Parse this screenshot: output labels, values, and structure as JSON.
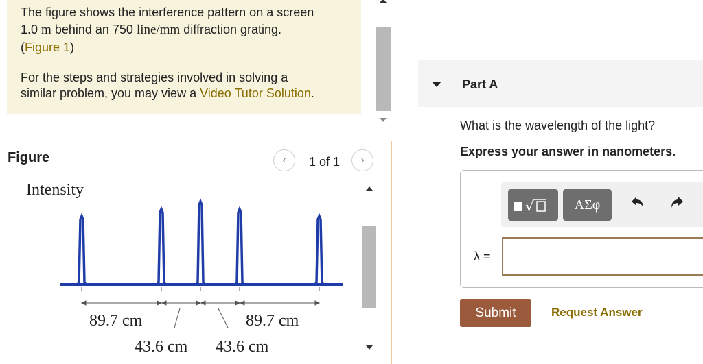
{
  "intro": {
    "line1": "The figure shows the interference pattern on a screen",
    "line2_value": "1.0",
    "line2_unit": "m",
    "line2_mid": " behind an 750 ",
    "line2_grating": "line/mm",
    "line2_end": " diffraction grating.",
    "figure_link_open": "(",
    "figure_link": "Figure 1",
    "figure_link_close": ")",
    "para2_line1": "For the steps and strategies involved in solving a",
    "para2_line2_start": "similar problem, you may view a ",
    "video_link": "Video Tutor Solution",
    "para2_line2_end": "."
  },
  "figure": {
    "title": "Figure",
    "pager": "1 of 1",
    "prev_icon": "chevron-left-icon",
    "next_icon": "chevron-right-icon",
    "ylabel": "Intensity",
    "dim_left": "89.7 cm",
    "dim_right": "89.7 cm",
    "dim_center_left": "43.6 cm",
    "dim_center_right": "43.6 cm",
    "line_color": "#1f3ca8"
  },
  "part": {
    "label": "Part A",
    "question": "What is the wavelength of the light?",
    "instruction": "Express your answer in nanometers.",
    "toolbar": {
      "templates_icon": "sqrt-template-icon",
      "symbols_label": "ΑΣφ",
      "undo_icon": "undo-icon",
      "redo_icon": "redo-icon"
    },
    "variable_label": "λ =",
    "answer_value": "",
    "submit_label": "Submit",
    "request_label": "Request Answer"
  },
  "colors": {
    "intro_bg": "#f7f3dc",
    "link": "#8a6d00",
    "submit_bg": "#9b5a3c",
    "input_border": "#9b7b55"
  }
}
